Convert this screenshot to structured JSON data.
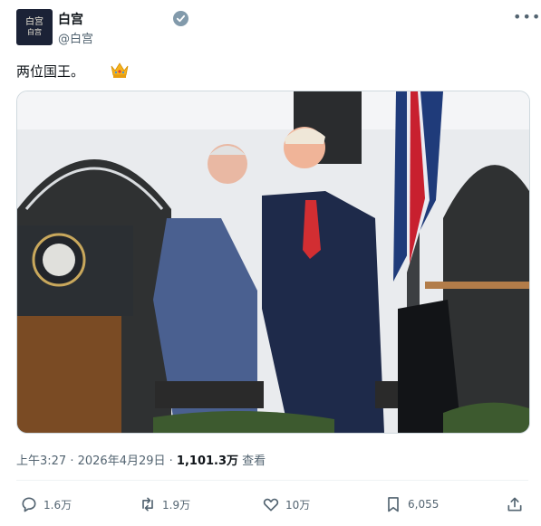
{
  "account": {
    "avatar_glyph": "白宫",
    "avatar_text": "白宫",
    "display_name": "白宫",
    "handle": "@白宫"
  },
  "post": {
    "text": "两位国王。",
    "emoji": "crown-icon"
  },
  "meta": {
    "time": "上午3:27",
    "sep1": " · ",
    "date": "2026年4月29日",
    "sep2": " · ",
    "views_count": "1,101.3万",
    "views_label": " 查看"
  },
  "actions": {
    "replies": "1.6万",
    "reposts": "1.9万",
    "likes": "10万",
    "bookmarks": "6,055"
  },
  "colors": {
    "secondary_text": "#536471",
    "primary_text": "#0f1419",
    "verified_badge": "#829aab",
    "divider": "#eff3f4"
  }
}
